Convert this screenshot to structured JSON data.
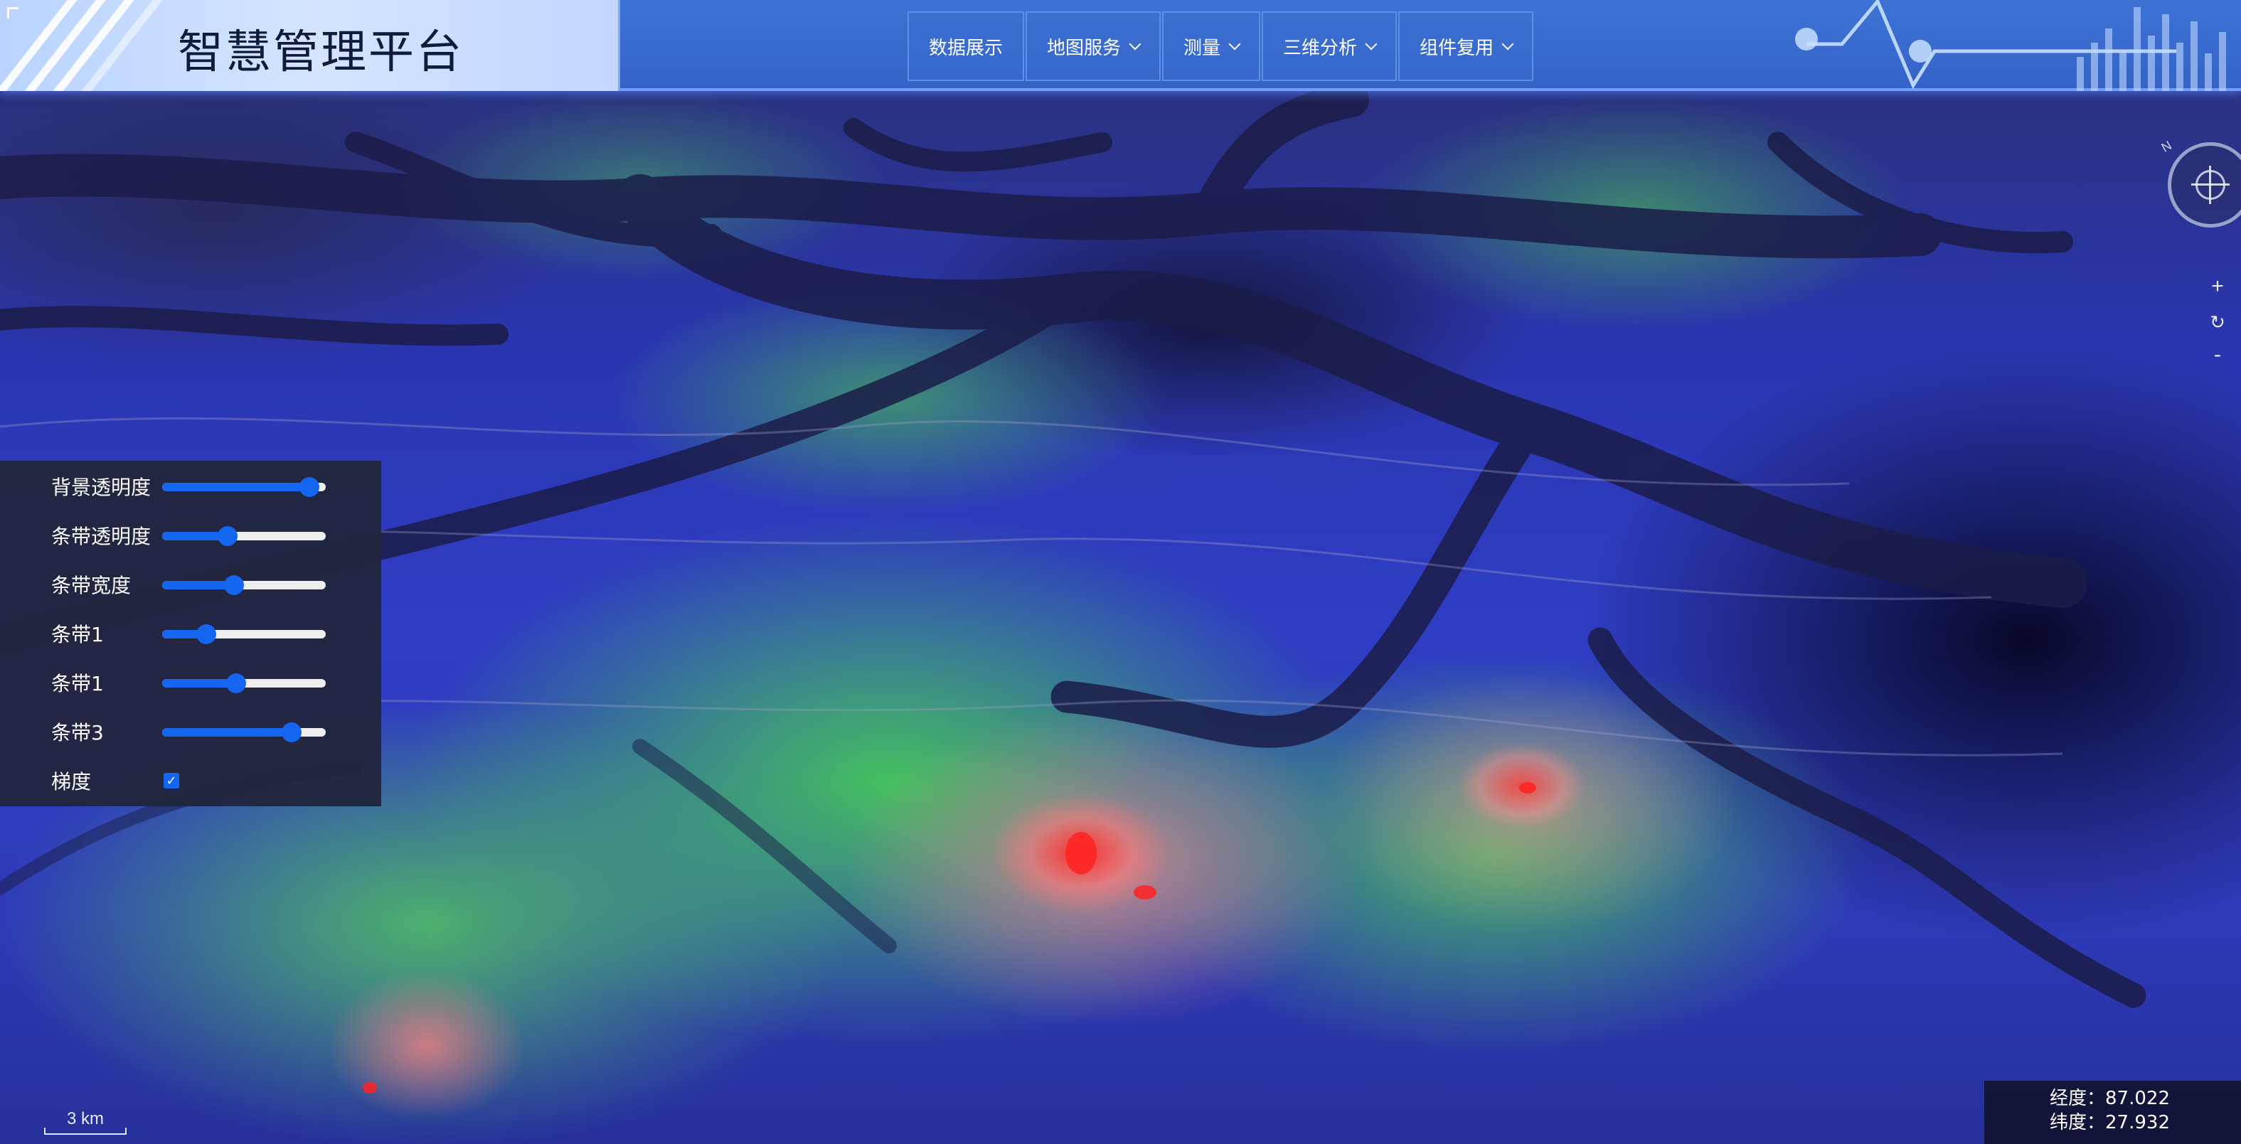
{
  "header": {
    "title": "智慧管理平台",
    "nav": [
      {
        "label": "数据展示",
        "has_dropdown": false
      },
      {
        "label": "地图服务",
        "has_dropdown": true
      },
      {
        "label": "测量",
        "has_dropdown": true
      },
      {
        "label": "三维分析",
        "has_dropdown": true
      },
      {
        "label": "组件复用",
        "has_dropdown": true
      }
    ]
  },
  "map_controls": {
    "compass_north": "N",
    "zoom_in": "+",
    "reset": "↻",
    "zoom_out": "-"
  },
  "panel": {
    "rows": [
      {
        "label": "背景透明度",
        "value": 0.9
      },
      {
        "label": "条带透明度",
        "value": 0.4
      },
      {
        "label": "条带宽度",
        "value": 0.44
      },
      {
        "label": "条带1",
        "value": 0.27
      },
      {
        "label": "条带1",
        "value": 0.45
      },
      {
        "label": "条带3",
        "value": 0.79
      }
    ],
    "checkbox": {
      "label": "梯度",
      "checked": true
    }
  },
  "scale": {
    "label": "3 km"
  },
  "coords": {
    "lon_label": "经度：87.022",
    "lat_label": "纬度：27.932"
  },
  "colors": {
    "accent": "#1466f0",
    "header": "#3d73d4",
    "panel_bg": "#21253c"
  }
}
